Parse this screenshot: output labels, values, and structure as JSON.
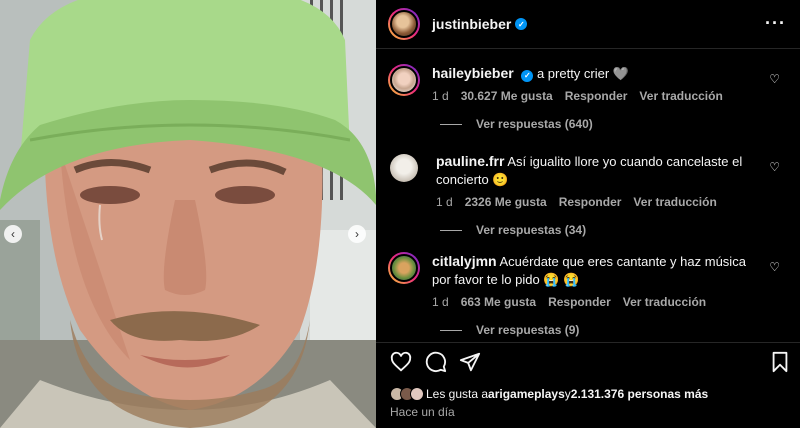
{
  "post": {
    "author": "justinbieber",
    "more_icon": "more-dots-icon"
  },
  "comments": [
    {
      "user": "haileybieber",
      "verified": true,
      "text": "a pretty crier 🩶",
      "time": "1 d",
      "likes": "30.627 Me gusta",
      "reply": "Responder",
      "translate": "Ver traducción",
      "view_replies": "Ver respuestas (640)"
    },
    {
      "user": "pauline.frr",
      "verified": false,
      "text": "Así igualito llore yo cuando cancelaste el concierto 🙂",
      "time": "1 d",
      "likes": "2326 Me gusta",
      "reply": "Responder",
      "translate": "Ver traducción",
      "view_replies": "Ver respuestas (34)"
    },
    {
      "user": "citlalyjmn",
      "verified": false,
      "text": "Acuérdate que eres cantante y haz música por favor te lo pido 😭 😭",
      "time": "1 d",
      "likes": "663 Me gusta",
      "reply": "Responder",
      "translate": "Ver traducción",
      "view_replies": "Ver respuestas (9)"
    }
  ],
  "footer": {
    "likes_prefix": "Les gusta a ",
    "likes_user": "arigameplays",
    "likes_mid": " y ",
    "likes_count": "2.131.376 personas más",
    "time_ago": "Hace un día"
  },
  "colors": {
    "verified": "#0095f6",
    "muted": "#a8a8a8",
    "background": "#000000",
    "hat": "#a8d98a"
  },
  "photo": {
    "nav_prev": "‹",
    "nav_next": "›"
  }
}
